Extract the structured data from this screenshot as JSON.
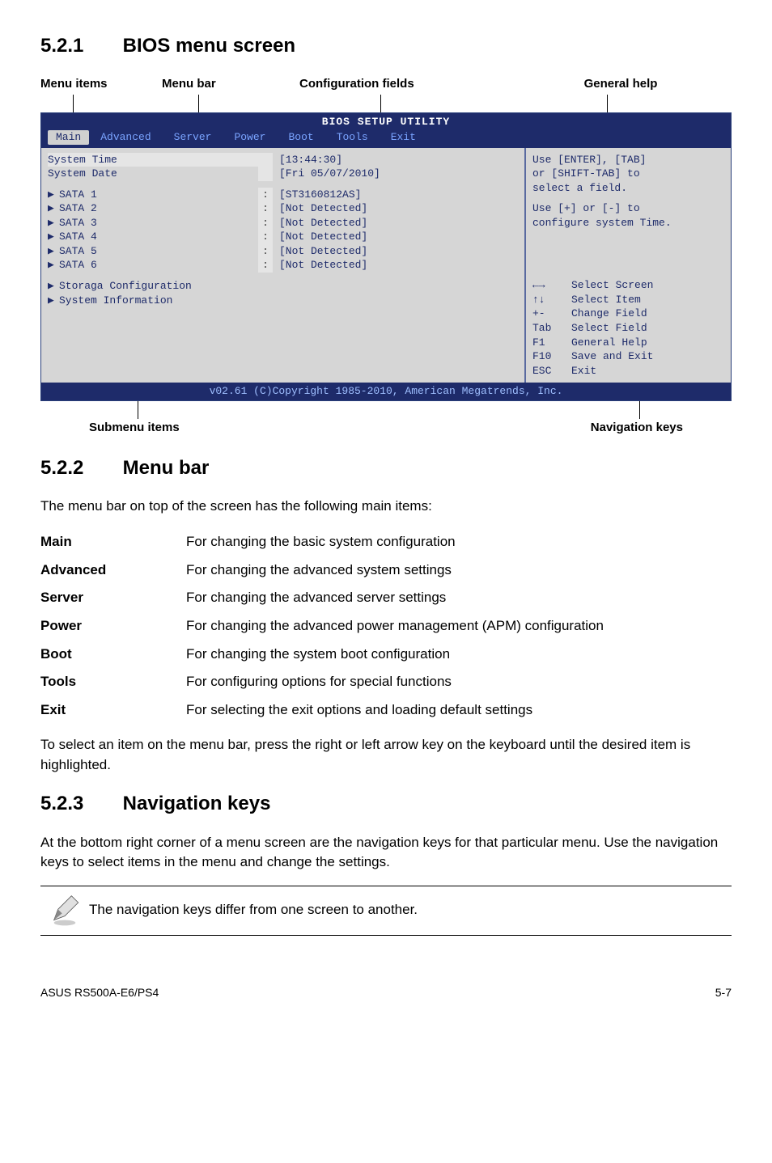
{
  "section_521": {
    "num": "5.2.1",
    "title": "BIOS menu screen"
  },
  "callouts_top": {
    "menu_items": "Menu items",
    "menu_bar": "Menu bar",
    "config_fields": "Configuration fields",
    "general_help": "General help"
  },
  "bios": {
    "title": "BIOS SETUP UTILITY",
    "tabs": {
      "main": "Main",
      "advanced": "Advanced",
      "server": "Server",
      "power": "Power",
      "boot": "Boot",
      "tools": "Tools",
      "exit": "Exit"
    },
    "left": {
      "system_time_lbl": "System Time",
      "system_time_val": "[13:44:30]",
      "system_date_lbl": "System Date",
      "system_date_val": "[Fri 05/07/2010]",
      "sata1_lbl": "SATA 1",
      "sata1_val": "[ST3160812AS]",
      "sata2_lbl": "SATA 2",
      "sata2_val": "[Not Detected]",
      "sata3_lbl": "SATA 3",
      "sata3_val": "[Not Detected]",
      "sata4_lbl": "SATA 4",
      "sata4_val": "[Not Detected]",
      "sata5_lbl": "SATA 5",
      "sata5_val": "[Not Detected]",
      "sata6_lbl": "SATA 6",
      "sata6_val": "[Not Detected]",
      "storage_cfg": "Storaga Configuration",
      "sys_info": "System Information"
    },
    "help": {
      "l1": "Use [ENTER], [TAB]",
      "l2": "or [SHIFT-TAB] to",
      "l3": "select a field.",
      "l4": "Use [+] or [-] to",
      "l5": "configure system Time.",
      "k_arrows_lr": "←→",
      "k_arrows_lr_t": "Select Screen",
      "k_arrows_ud": "↑↓",
      "k_arrows_ud_t": "Select Item",
      "k_pm": "+-",
      "k_pm_t": "Change Field",
      "k_tab": "Tab",
      "k_tab_t": "Select Field",
      "k_f1": "F1",
      "k_f1_t": "General Help",
      "k_f10": "F10",
      "k_f10_t": "Save and Exit",
      "k_esc": "ESC",
      "k_esc_t": "Exit"
    },
    "footer": "v02.61 (C)Copyright 1985-2010, American Megatrends, Inc."
  },
  "callouts_bot": {
    "submenu": "Submenu items",
    "navkeys": "Navigation keys"
  },
  "section_522": {
    "num": "5.2.2",
    "title": "Menu bar"
  },
  "p_522": "The menu bar on top of the screen has the following main items:",
  "defs": [
    {
      "term": "Main",
      "desc": "For changing the basic system configuration"
    },
    {
      "term": "Advanced",
      "desc": "For changing the advanced system settings"
    },
    {
      "term": "Server",
      "desc": "For changing the advanced server settings"
    },
    {
      "term": "Power",
      "desc": "For changing the advanced power management (APM) configuration"
    },
    {
      "term": "Boot",
      "desc": "For changing the system boot configuration"
    },
    {
      "term": "Tools",
      "desc": "For configuring options for special functions"
    },
    {
      "term": "Exit",
      "desc": "For selecting the exit options and loading default settings"
    }
  ],
  "p_522b": "To select an item on the menu bar, press the right or left arrow key on the keyboard until the desired item is highlighted.",
  "section_523": {
    "num": "5.2.3",
    "title": "Navigation keys"
  },
  "p_523": "At the bottom right corner of a menu screen are the navigation keys for that particular menu. Use the navigation keys to select items in the menu and change the settings.",
  "note_text": "The navigation keys differ from one screen to another.",
  "footer": {
    "left": "ASUS RS500A-E6/PS4",
    "right": "5-7"
  }
}
